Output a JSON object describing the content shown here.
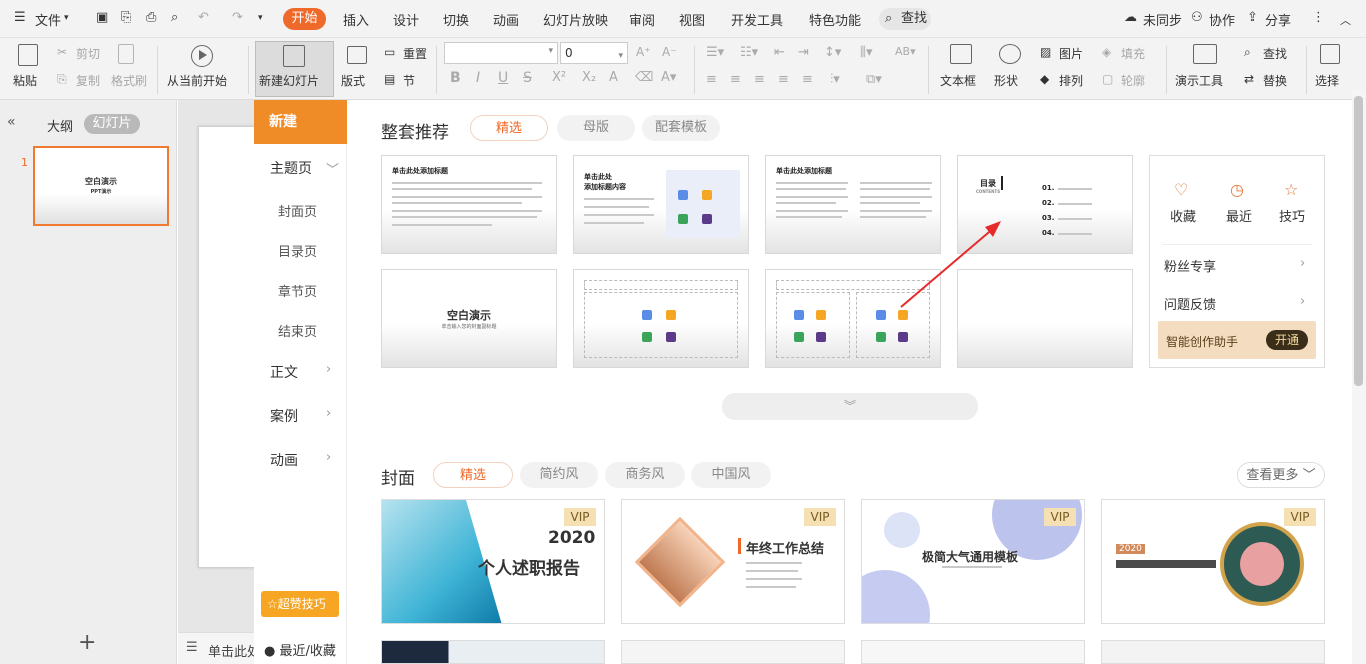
{
  "menubar": {
    "file": "文件",
    "tabs": [
      "开始",
      "插入",
      "设计",
      "切换",
      "动画",
      "幻灯片放映",
      "审阅",
      "视图",
      "开发工具",
      "特色功能"
    ],
    "search": "查找",
    "unsync": "未同步",
    "collab": "协作",
    "share": "分享"
  },
  "ribbon": {
    "paste": "粘贴",
    "cut": "剪切",
    "copy": "复制",
    "format_painter": "格式刷",
    "play_from_current": "从当前开始",
    "new_slide": "新建幻灯片",
    "layout": "版式",
    "reset": "重置",
    "section": "节",
    "font_size": "0",
    "textbox": "文本框",
    "shape": "形状",
    "picture": "图片",
    "fill": "填充",
    "arrange": "排列",
    "outline": "轮廓",
    "present_tools": "演示工具",
    "find": "查找",
    "replace": "替换",
    "select": "选择"
  },
  "left_panel": {
    "outline_tab": "大纲",
    "slides_tab": "幻灯片",
    "slide_number": "1",
    "thumb_title": "空白演示",
    "thumb_sub": "PPT演示",
    "add": "+"
  },
  "notes": {
    "placeholder": "单击此处"
  },
  "nav": {
    "new": "新建",
    "theme": "主题页",
    "cover": "封面页",
    "toc": "目录页",
    "chapter": "章节页",
    "end": "结束页",
    "body": "正文",
    "case": "案例",
    "animation": "动画",
    "tips": "超赞技巧",
    "recent_fav": "最近/收藏"
  },
  "suite": {
    "title": "整套推荐",
    "tabs": [
      "精选",
      "母版",
      "配套模板"
    ],
    "card_title": "单击此处添加标题",
    "card_title_2a": "单击此处",
    "card_title_2b": "添加标题内容",
    "toc_title": "目录",
    "toc_sub": "CONTENTS",
    "toc_items": [
      "01.",
      "02.",
      "03.",
      "04."
    ],
    "blank_title": "空白演示",
    "blank_sub": "单击输入您的封面副标题"
  },
  "side": {
    "fav": "收藏",
    "recent": "最近",
    "tips": "技巧",
    "fans": "粉丝专享",
    "feedback": "问题反馈",
    "ai": "智能创作助手",
    "open": "开通"
  },
  "cover": {
    "title": "封面",
    "tabs": [
      "精选",
      "简约风",
      "商务风",
      "中国风"
    ],
    "more": "查看更多",
    "vip": "VIP",
    "c1_year": "2020",
    "c1_title": "个人述职报告",
    "c2_title": "年终工作总结",
    "c3_title": "极简大气通用模板",
    "c4_year": "2020"
  }
}
